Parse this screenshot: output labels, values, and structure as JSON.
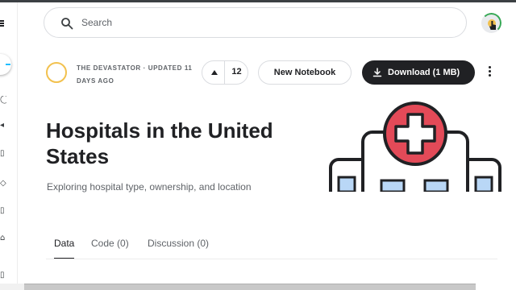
{
  "search": {
    "placeholder": "Search"
  },
  "owner": {
    "meta": "THE DEVASTATOR · UPDATED 11 DAYS AGO"
  },
  "vote": {
    "count": "12"
  },
  "actions": {
    "new_notebook": "New Notebook",
    "download": "Download (1 MB)"
  },
  "dataset": {
    "title": "Hospitals in the United States",
    "subtitle": "Exploring hospital type, ownership, and location"
  },
  "tabs": [
    {
      "label": "Data"
    },
    {
      "label": "Code (0)"
    },
    {
      "label": "Discussion (0)"
    }
  ],
  "colors": {
    "accent": "#20beff",
    "dark": "#202124",
    "hero_red": "#e34a58",
    "hero_blue": "#b9d7f6"
  }
}
